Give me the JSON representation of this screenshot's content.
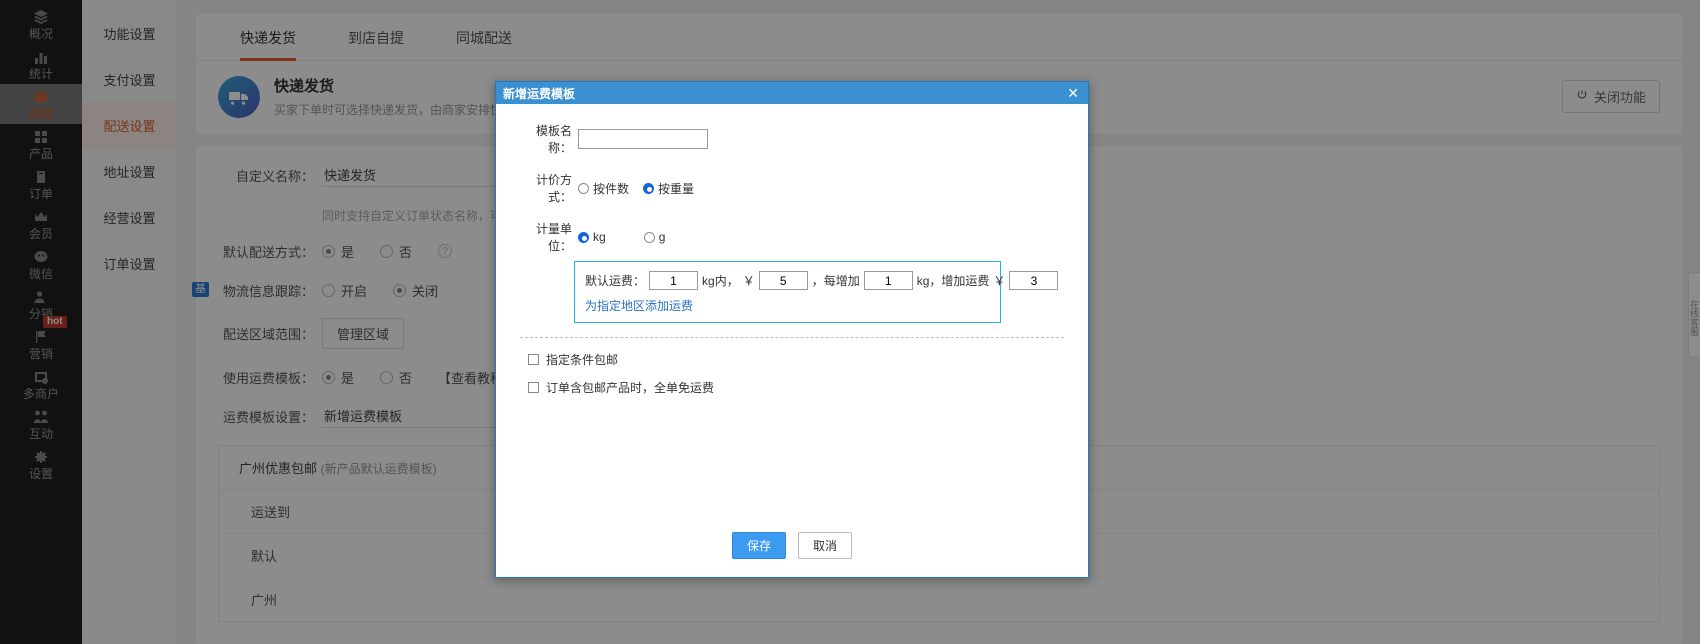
{
  "sidebar": {
    "items": [
      {
        "label": "概况",
        "icon": "layers-icon",
        "active": false,
        "badge": null
      },
      {
        "label": "统计",
        "icon": "bar-chart-icon",
        "active": false,
        "badge": null
      },
      {
        "label": "商城",
        "icon": "shop-bag-icon",
        "active": true,
        "badge": null
      },
      {
        "label": "产品",
        "icon": "grid-icon",
        "active": false,
        "badge": null
      },
      {
        "label": "订单",
        "icon": "clipboard-icon",
        "active": false,
        "badge": null
      },
      {
        "label": "会员",
        "icon": "crown-icon",
        "active": false,
        "badge": null
      },
      {
        "label": "微信",
        "icon": "wechat-icon",
        "active": false,
        "badge": null
      },
      {
        "label": "分销",
        "icon": "user-share-icon",
        "active": false,
        "badge": null
      },
      {
        "label": "营销",
        "icon": "flag-icon",
        "active": false,
        "badge": "hot"
      },
      {
        "label": "多商户",
        "icon": "multi-store-icon",
        "active": false,
        "badge": null
      },
      {
        "label": "互动",
        "icon": "people-icon",
        "active": false,
        "badge": null
      },
      {
        "label": "设置",
        "icon": "gear-icon",
        "active": false,
        "badge": null
      }
    ]
  },
  "submenu": {
    "items": [
      {
        "label": "功能设置",
        "active": false
      },
      {
        "label": "支付设置",
        "active": false
      },
      {
        "label": "配送设置",
        "active": true
      },
      {
        "label": "地址设置",
        "active": false
      },
      {
        "label": "经营设置",
        "active": false
      },
      {
        "label": "订单设置",
        "active": false
      }
    ]
  },
  "tabs": [
    {
      "label": "快递发货",
      "active": true
    },
    {
      "label": "到店自提",
      "active": false
    },
    {
      "label": "同城配送",
      "active": false
    }
  ],
  "banner": {
    "icon": "delivery-truck-icon",
    "title": "快递发货",
    "subtitle": "买家下单时可选择快递发货，由商家安排快递送货上门",
    "close_button": "关闭功能",
    "close_icon": "power-icon"
  },
  "form": {
    "custom_name": {
      "label": "自定义名称：",
      "value": "快递发货"
    },
    "custom_name_hint": "同时支持自定义订单状态名称，可前往",
    "default_delivery": {
      "label": "默认配送方式：",
      "options": [
        "是",
        "否"
      ],
      "selected": "是",
      "help": "?"
    },
    "logistics_track": {
      "label": "物流信息跟踪：",
      "tag": "基",
      "options": [
        "开启",
        "关闭"
      ],
      "selected": "关闭"
    },
    "delivery_area": {
      "label": "配送区域范围：",
      "button": "管理区域"
    },
    "use_template": {
      "label": "使用运费模板：",
      "options": [
        "是",
        "否"
      ],
      "selected": "是",
      "tutorial": "【查看教程】"
    },
    "template_setting": {
      "label": "运费模板设置：",
      "value": "新增运费模板"
    },
    "template_table": {
      "header_name": "广州优惠包邮",
      "header_note": "(新产品默认运费模板)",
      "rows": [
        "运送到",
        "默认",
        "广州"
      ]
    }
  },
  "side_tab": "在线客服",
  "modal": {
    "title": "新增运费模板",
    "close_icon": "close-icon",
    "template_name": {
      "label": "模板名称：",
      "value": "",
      "placeholder": ""
    },
    "pricing_method": {
      "label": "计价方式：",
      "options": [
        "按件数",
        "按重量"
      ],
      "selected": "按重量"
    },
    "weight_unit": {
      "label": "计量单位：",
      "options": [
        "kg",
        "g"
      ],
      "selected": "kg"
    },
    "fee": {
      "prefix": "默认运费：",
      "first_weight": "1",
      "unit_text": "kg内，",
      "currency": "￥",
      "first_price": "5",
      "mid_text": "，每增加",
      "step_weight": "1",
      "step_unit": "kg，增加运费",
      "currency2": "￥",
      "step_price": "3",
      "region_link": "为指定地区添加运费"
    },
    "checkboxes": [
      {
        "label": "指定条件包邮",
        "checked": false
      },
      {
        "label": "订单含包邮产品时，全单免运费",
        "checked": false
      }
    ],
    "save_button": "保存",
    "cancel_button": "取消"
  },
  "colors": {
    "accent": "#e2622a",
    "modal_header": "#3b90d1",
    "fee_border": "#22b0e8",
    "link": "#2a72c8",
    "primary_button": "#3b9bf0",
    "badge": "#c0392b"
  }
}
